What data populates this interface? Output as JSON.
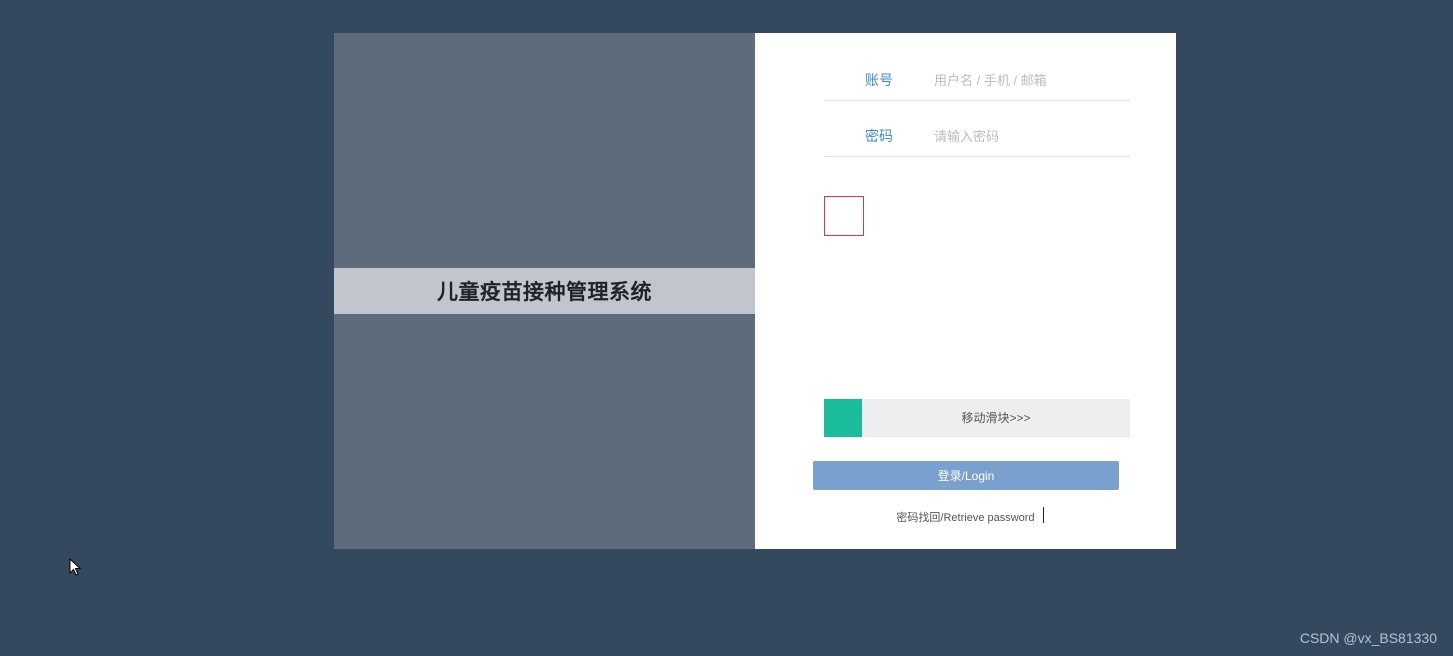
{
  "left_panel": {
    "system_title": "儿童疫苗接种管理系统"
  },
  "form": {
    "account_label": "账号",
    "account_placeholder": "用户名 / 手机 / 邮箱",
    "account_value": "",
    "password_label": "密码",
    "password_placeholder": "请输入密码",
    "password_value": ""
  },
  "slider": {
    "text": "移动滑块>>>",
    "progress": 0
  },
  "login_button_label": "登录/Login",
  "retrieve_password_label": "密码找回/Retrieve password",
  "watermark": "CSDN @vx_BS81330",
  "colors": {
    "background": "#35495e",
    "left_panel": "#5e6b7d",
    "title_band": "#c0c5ce",
    "label_accent": "#3a8fc8",
    "slider_handle": "#1abc9c",
    "login_button": "#7aa0d0",
    "captcha_border": "#e0383e"
  },
  "icons": {
    "cursor": "mouse-pointer-icon"
  }
}
